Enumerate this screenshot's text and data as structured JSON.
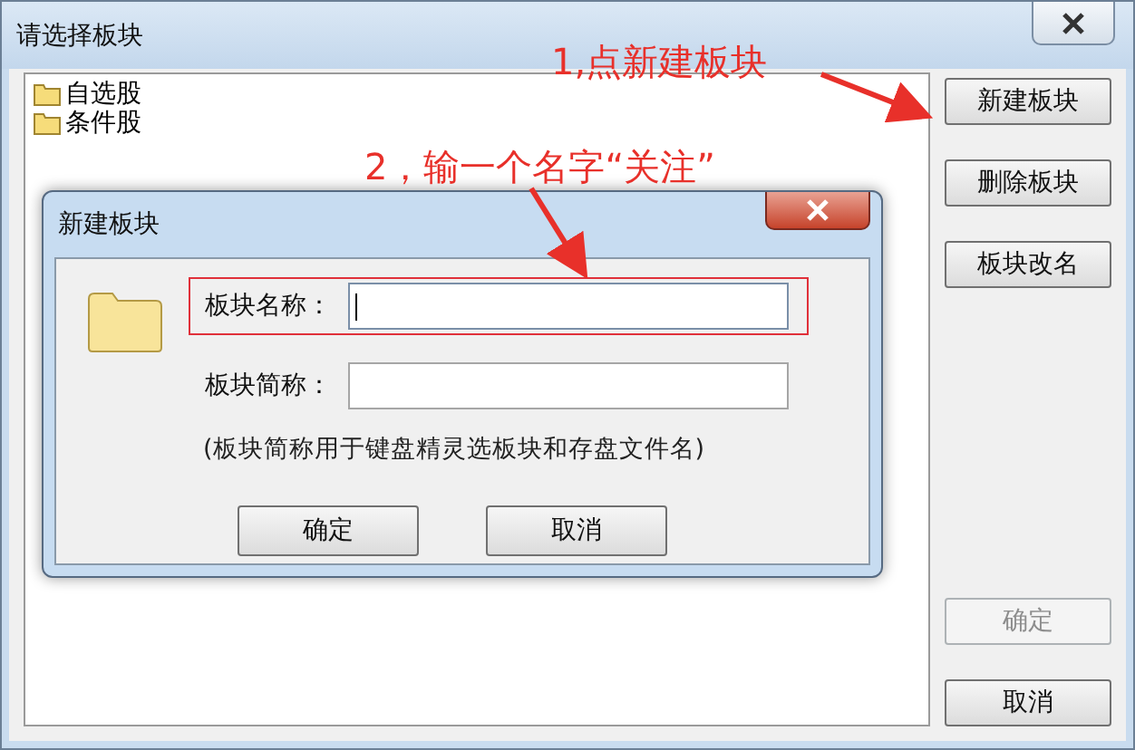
{
  "window": {
    "title": "请选择板块"
  },
  "tree": [
    {
      "label": "自选股"
    },
    {
      "label": "条件股"
    }
  ],
  "buttons": [
    {
      "label": "新建板块",
      "disabled": false
    },
    {
      "label": "删除板块",
      "disabled": false
    },
    {
      "label": "板块改名",
      "disabled": false
    },
    {
      "label": "确定",
      "disabled": true
    },
    {
      "label": "取消",
      "disabled": false
    }
  ],
  "dialog": {
    "title": "新建板块",
    "fields": [
      {
        "label": "板块名称：",
        "focused": true,
        "highlighted": true
      },
      {
        "label": "板块简称：",
        "focused": false,
        "highlighted": false
      }
    ],
    "note": "(板块简称用于键盘精灵选板块和存盘文件名)",
    "buttons": [
      "确定",
      "取消"
    ]
  },
  "annotations": [
    {
      "text": "1,点新建板块"
    },
    {
      "text": "2，输一个名字“关注”"
    }
  ]
}
